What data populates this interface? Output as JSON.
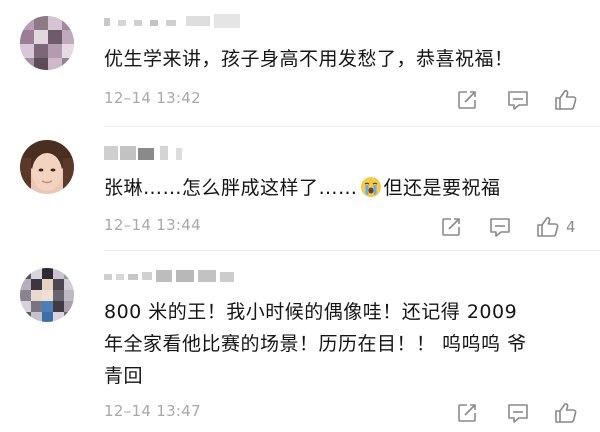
{
  "comments": [
    {
      "text": "优生学来讲，孩子身高不用发愁了，恭喜祝福！",
      "timestamp": "12–14 13:42",
      "likes": ""
    },
    {
      "text_before": "张琳……怎么胖成这样了……",
      "emoji": "crying-face",
      "text_after": "但还是要祝福",
      "timestamp": "12–14 13:44",
      "likes": "4"
    },
    {
      "line1": "800 米的王！我小时候的偶像哇！还记得 2009",
      "line2": "年全家看他比赛的场景！历历在目！！ 呜呜呜 爷",
      "line3": "青回",
      "timestamp": "12–14 13:47",
      "likes": ""
    }
  ],
  "icons": {
    "share": "share-icon",
    "reply": "reply-icon",
    "like": "thumbs-up-icon"
  },
  "colors": {
    "text": "#151515",
    "meta": "#a9a9a9",
    "icon": "#8a8a8a"
  }
}
